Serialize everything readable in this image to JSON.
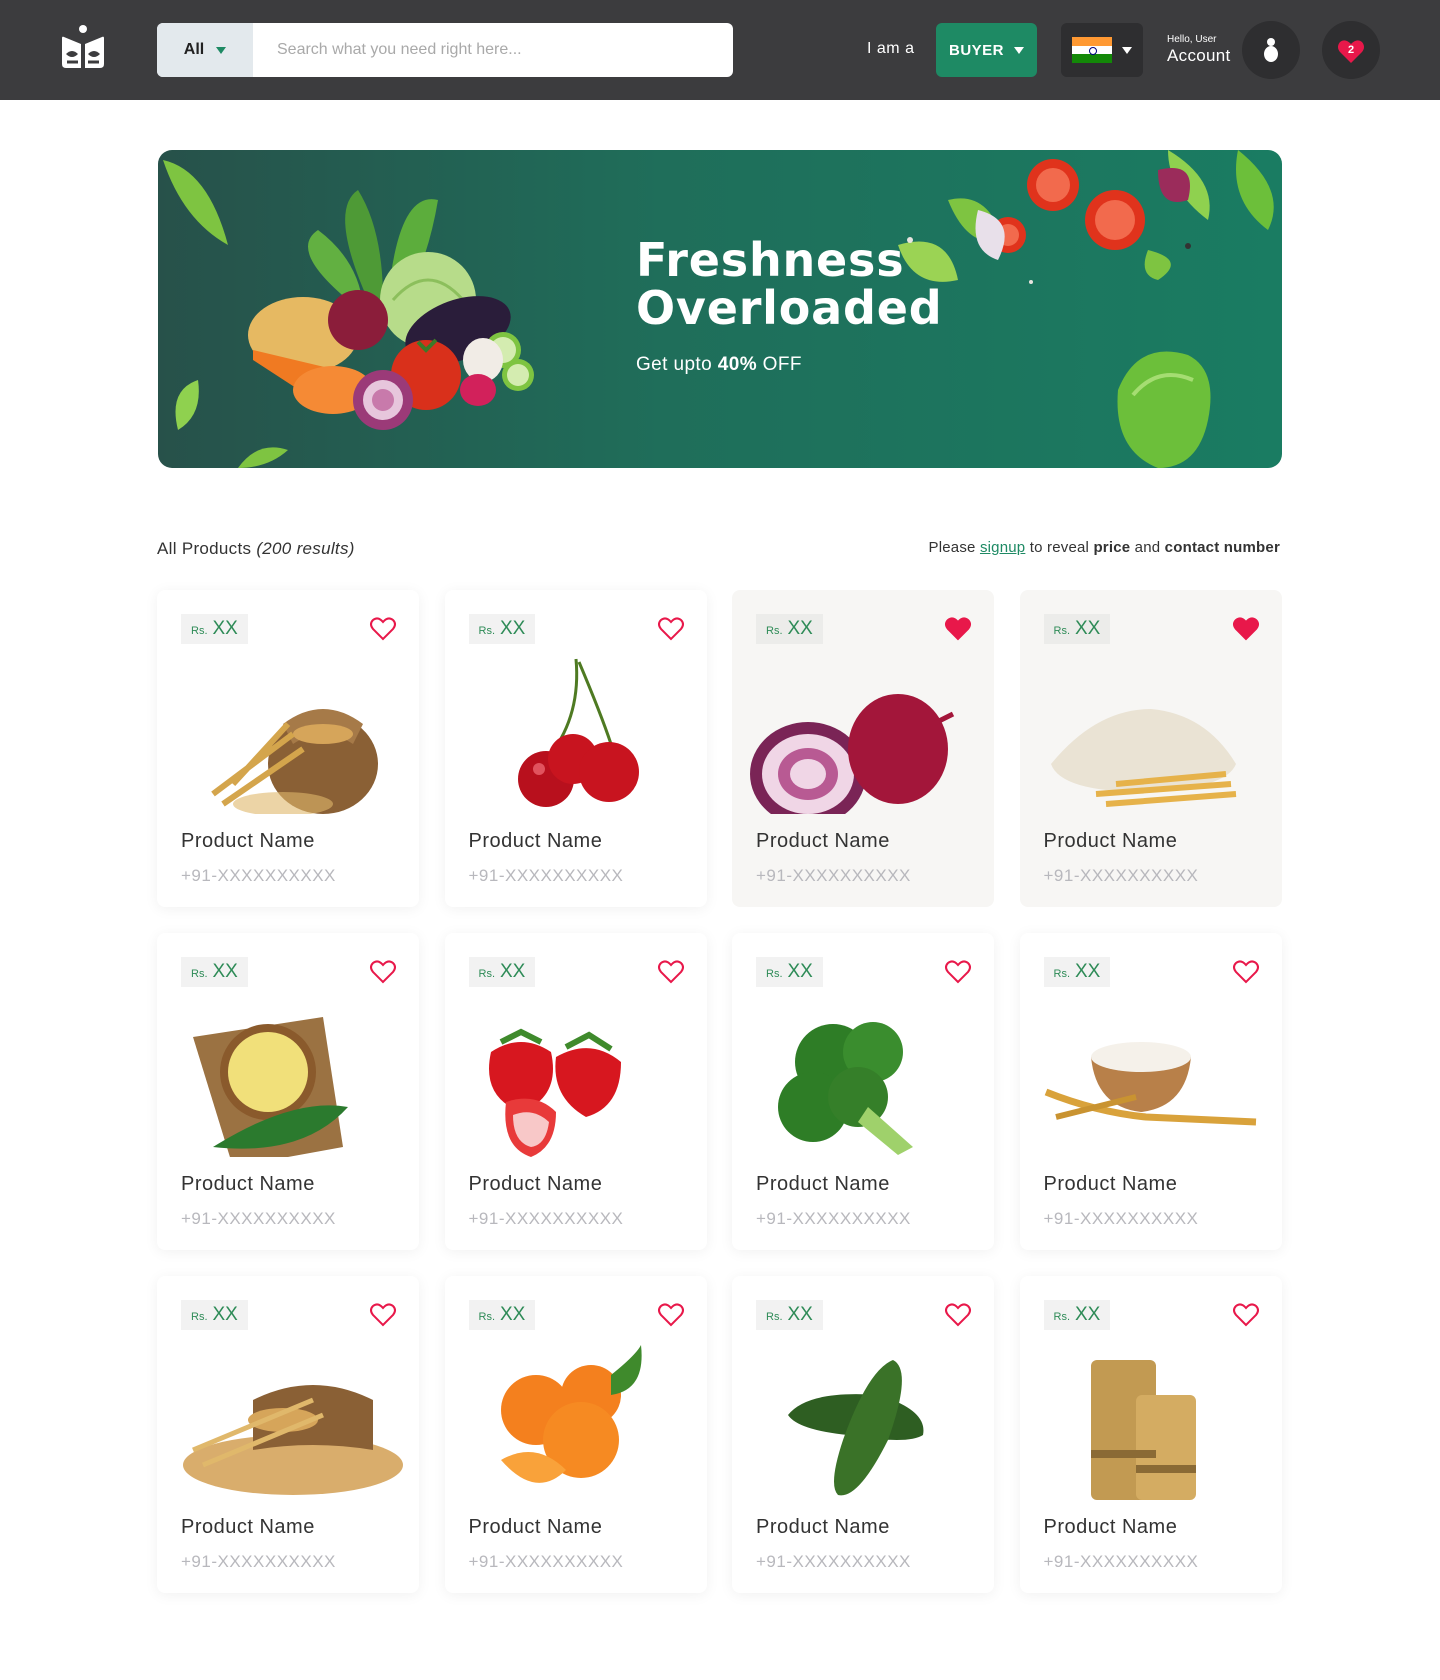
{
  "header": {
    "search_category": "All",
    "search_placeholder": "Search what you need right here...",
    "iam_label": "I am a",
    "role_label": "BUYER",
    "country_icon": "india-flag-icon",
    "hello_text": "Hello, User",
    "account_label": "Account",
    "wishlist_count": "2",
    "colors": {
      "header_bg": "#3c3c3e",
      "accent": "#1e8a64",
      "heart": "#e8184a"
    }
  },
  "banner": {
    "title_line1": "Freshness",
    "title_line2": "Overloaded",
    "sub_prefix": "Get upto ",
    "sub_value": "40%",
    "sub_suffix": " OFF"
  },
  "listing": {
    "label": "All Products ",
    "count": "(200 results)",
    "notice_prefix": "Please ",
    "notice_link": "signup",
    "notice_mid": " to reveal ",
    "notice_bold1": "price",
    "notice_and": " and ",
    "notice_bold2": "contact number"
  },
  "products": [
    {
      "rs": "Rs.",
      "price": "XX",
      "name": "Product Name",
      "phone": "+91-XXXXXXXXXX",
      "image": "wheat-sack",
      "liked": false
    },
    {
      "rs": "Rs.",
      "price": "XX",
      "name": "Product Name",
      "phone": "+91-XXXXXXXXXX",
      "image": "cherries",
      "liked": false
    },
    {
      "rs": "Rs.",
      "price": "XX",
      "name": "Product Name",
      "phone": "+91-XXXXXXXXXX",
      "image": "red-onion",
      "liked": true
    },
    {
      "rs": "Rs.",
      "price": "XX",
      "name": "Product Name",
      "phone": "+91-XXXXXXXXXX",
      "image": "flour-heap",
      "liked": true
    },
    {
      "rs": "Rs.",
      "price": "XX",
      "name": "Product Name",
      "phone": "+91-XXXXXXXXXX",
      "image": "cornmeal-bowl",
      "liked": false
    },
    {
      "rs": "Rs.",
      "price": "XX",
      "name": "Product Name",
      "phone": "+91-XXXXXXXXXX",
      "image": "strawberries",
      "liked": false
    },
    {
      "rs": "Rs.",
      "price": "XX",
      "name": "Product Name",
      "phone": "+91-XXXXXXXXXX",
      "image": "broccoli",
      "liked": false
    },
    {
      "rs": "Rs.",
      "price": "XX",
      "name": "Product Name",
      "phone": "+91-XXXXXXXXXX",
      "image": "rice-bowl",
      "liked": false
    },
    {
      "rs": "Rs.",
      "price": "XX",
      "name": "Product Name",
      "phone": "+91-XXXXXXXXXX",
      "image": "grain-sack",
      "liked": false
    },
    {
      "rs": "Rs.",
      "price": "XX",
      "name": "Product Name",
      "phone": "+91-XXXXXXXXXX",
      "image": "oranges",
      "liked": false
    },
    {
      "rs": "Rs.",
      "price": "XX",
      "name": "Product Name",
      "phone": "+91-XXXXXXXXXX",
      "image": "cucumbers",
      "liked": false
    },
    {
      "rs": "Rs.",
      "price": "XX",
      "name": "Product Name",
      "phone": "+91-XXXXXXXXXX",
      "image": "wheat-bundles",
      "liked": false
    }
  ]
}
